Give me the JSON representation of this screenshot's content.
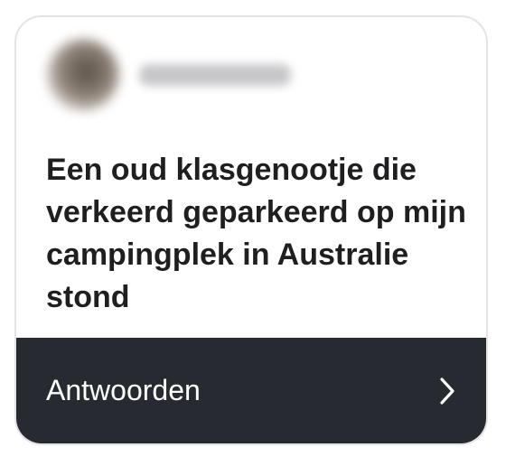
{
  "post": {
    "username": "brandaliho",
    "question": "Een oud klasgenootje die verkeerd geparkeerd op mijn campingplek in Australie stond"
  },
  "footer": {
    "reply_label": "Antwoorden",
    "chevron_icon": "chevron-right-icon"
  },
  "colors": {
    "footer_bg": "#272a30",
    "text": "#1f1f22",
    "border": "#e4e4e6"
  }
}
